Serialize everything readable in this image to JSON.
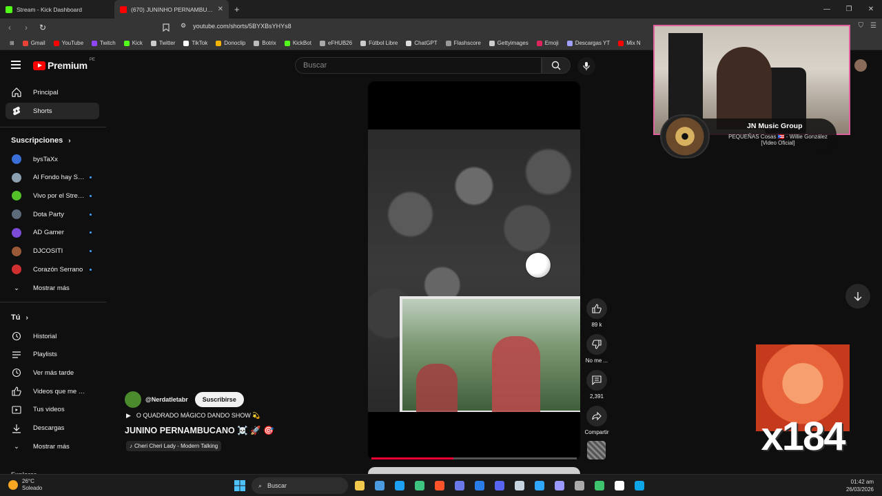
{
  "browser": {
    "tabs": [
      {
        "title": "Stream - Kick Dashboard",
        "color": "#53fc18"
      },
      {
        "title": "(670) JUNINHO PERNAMBUCANO",
        "color": "#ff0000"
      }
    ],
    "url": "youtube.com/shorts/5BYXBsYHYs8",
    "bookmarks": [
      {
        "label": "Gmail",
        "color": "#ea4335"
      },
      {
        "label": "YouTube",
        "color": "#ff0000"
      },
      {
        "label": "Twitch",
        "color": "#9146ff"
      },
      {
        "label": "Kick",
        "color": "#53fc18"
      },
      {
        "label": "Twitter",
        "color": "#cccccc"
      },
      {
        "label": "TikTok",
        "color": "#ffffff"
      },
      {
        "label": "Donoclip",
        "color": "#f5b400"
      },
      {
        "label": "Botrix",
        "color": "#bbbbbb"
      },
      {
        "label": "KickBot",
        "color": "#53fc18"
      },
      {
        "label": "eFHUB26",
        "color": "#aaaaaa"
      },
      {
        "label": "Fútbol Libre",
        "color": "#cccccc"
      },
      {
        "label": "ChatGPT",
        "color": "#dddddd"
      },
      {
        "label": "Flashscore",
        "color": "#999999"
      },
      {
        "label": "Gettyimages",
        "color": "#cccccc"
      },
      {
        "label": "Emoji",
        "color": "#e0245e"
      },
      {
        "label": "Descargas YT",
        "color": "#a0a0ff"
      },
      {
        "label": "Mix N",
        "color": "#ff0000"
      }
    ]
  },
  "youtube": {
    "logo_text": "Premium",
    "logo_region": "PE",
    "search_placeholder": "Buscar"
  },
  "sidebar": {
    "main": [
      {
        "label": "Principal",
        "icon": "home-icon"
      },
      {
        "label": "Shorts",
        "icon": "shorts-icon",
        "active": true
      }
    ],
    "subscriptions_title": "Suscripciones",
    "subscriptions": [
      {
        "label": "bysTaXx",
        "color": "#3a6fd8",
        "dot": false
      },
      {
        "label": "Al Fondo hay Siti...",
        "color": "#8aa0b0",
        "dot": true
      },
      {
        "label": "Vivo por el Strea...",
        "color": "#53c22a",
        "dot": true
      },
      {
        "label": "Dota Party",
        "color": "#5c6a7a",
        "dot": true
      },
      {
        "label": "AD Gamer",
        "color": "#7b4bd6",
        "dot": true
      },
      {
        "label": "DJCOSITI",
        "color": "#9a5a3a",
        "dot": true
      },
      {
        "label": "Corazón Serrano",
        "color": "#d03030",
        "dot": true
      }
    ],
    "show_more": "Mostrar más",
    "you_title": "Tú",
    "you": [
      {
        "label": "Historial",
        "icon": "history-icon"
      },
      {
        "label": "Playlists",
        "icon": "playlists-icon"
      },
      {
        "label": "Ver más tarde",
        "icon": "watch-later-icon"
      },
      {
        "label": "Videos que me gus...",
        "icon": "liked-videos-icon"
      },
      {
        "label": "Tus videos",
        "icon": "your-videos-icon"
      },
      {
        "label": "Descargas",
        "icon": "downloads-icon"
      }
    ],
    "show_more_2": "Mostrar más",
    "explore_title": "Explorar"
  },
  "short": {
    "channel": "@Nerdatletabr",
    "subscribe": "Suscribirse",
    "description": "O QUADRADO MÁGICO DANDO SHOW 💫",
    "title": "JUNINO PERNAMBUCANO ☠️ 🚀 🎯",
    "music": "Cheri Cheri Lady - Modern Talking",
    "progress": 0.4,
    "actions": {
      "likes": "89 k",
      "dislike": "No me ...",
      "comments": "2,391",
      "share": "Compartir"
    }
  },
  "overlay": {
    "music_title": "JN Music Group",
    "music_song": "PEQUEÑAS Cosas 🇵🇷 - Willie González [Video Oficial]",
    "counter": "x184"
  },
  "taskbar": {
    "temp": "26°C",
    "weather": "Soleado",
    "search": "Buscar",
    "time": "01:42 am",
    "date": "26/03/2026",
    "apps": [
      "#f2c94c",
      "#4a9be0",
      "#1da1f2",
      "#3dc47e",
      "#fb542b",
      "#6b78e8",
      "#2b7de9",
      "#5865f2",
      "#c7d5e0",
      "#31a8ff",
      "#9999ff",
      "#aaaaaa",
      "#3ec46d",
      "#ffffff",
      "#0ea5e9"
    ]
  }
}
